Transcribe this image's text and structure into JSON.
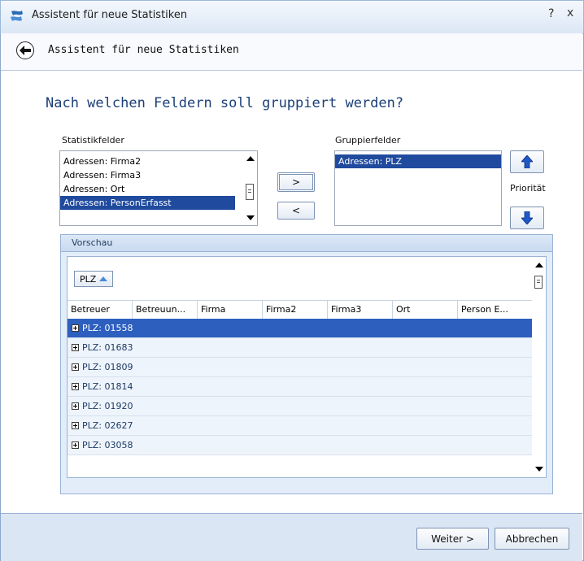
{
  "window": {
    "title": "Assistent für neue Statistiken",
    "help_glyph": "?",
    "close_glyph": "x"
  },
  "nav": {
    "title": "Assistent für neue Statistiken"
  },
  "question": "Nach welchen Feldern soll gruppiert werden?",
  "stat_fields": {
    "label": "Statistikfelder",
    "items": [
      "Adressen: Firma2",
      "Adressen: Firma3",
      "Adressen: Ort",
      "Adressen: PersonErfasst"
    ],
    "selected_index": 3
  },
  "buttons": {
    "move_right": ">",
    "move_left": "<",
    "next": "Weiter >",
    "cancel": "Abbrechen"
  },
  "group_fields": {
    "label": "Gruppierfelder",
    "items": [
      "Adressen: PLZ"
    ],
    "selected_index": 0
  },
  "priority_label": "Priorität",
  "preview": {
    "header": "Vorschau",
    "group_chip": "PLZ",
    "columns": [
      "Betreuer",
      "Betreuun...",
      "Firma",
      "Firma2",
      "Firma3",
      "Ort",
      "Person E..."
    ],
    "rows": [
      "PLZ: 01558",
      "PLZ: 01683",
      "PLZ: 01809",
      "PLZ: 01814",
      "PLZ: 01920",
      "PLZ: 02627",
      "PLZ: 03058"
    ],
    "selected_row": 0
  },
  "colors": {
    "accent": "#1f4a9e",
    "row_selected": "#2d5fbf",
    "arrow_blue": "#1f58c7",
    "heading": "#1c3f78"
  }
}
